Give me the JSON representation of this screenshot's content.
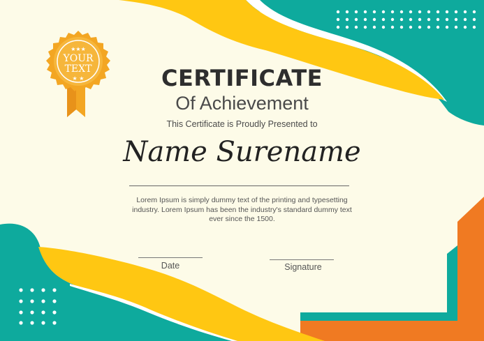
{
  "certificate": {
    "title": "CERTIFICATE",
    "subtitle": "Of Achievement",
    "presented_line": "This Certificate is Proudly Presented to",
    "recipient_name": "Name Surename",
    "body_text": "Lorem Ipsum is simply dummy text of the printing and typesetting industry. Lorem Ipsum has been the industry's standard dummy text ever since the 1500.",
    "date_label": "Date",
    "signature_label": "Signature"
  },
  "badge": {
    "line1": "YOUR",
    "line2": "TEXT",
    "stars_top": "★★★",
    "stars_bottom": "★ ★"
  },
  "colors": {
    "background": "#fdfbe8",
    "teal": "#0eaa9d",
    "yellow": "#ffc712",
    "orange": "#f07a22",
    "badge_gold": "#f3a623",
    "text_dark": "#2e2e2e"
  }
}
